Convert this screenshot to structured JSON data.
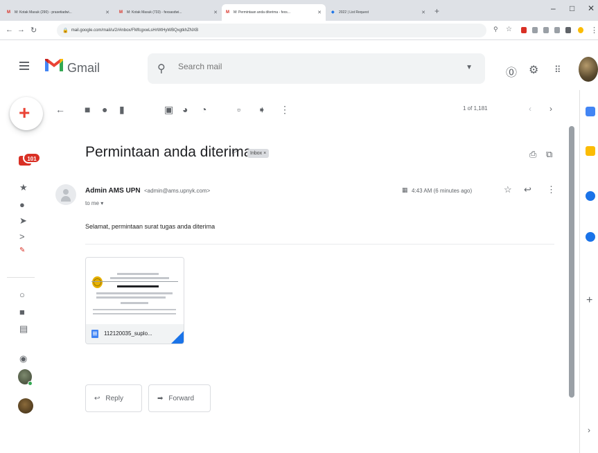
{
  "browser": {
    "tabs": [
      {
        "title": "M: Kotak Masuk (290) - prasetiadwi..."
      },
      {
        "title": "M: Kotak Masuk (733) - fexsasdwi..."
      },
      {
        "title": "M: Permintaan anda diterima - fexs..."
      },
      {
        "title": "2022 | List Request"
      }
    ],
    "url": "mail.google.com/mail/u/2/#inbox/FMfcgxwLsHrWtHyWBQxgtkhZNXB"
  },
  "gmail": {
    "brand": "Gmail",
    "search_placeholder": "Search mail"
  },
  "rail": {
    "inbox_badge": "101"
  },
  "toolbar": {
    "pager": "1 of 1,181"
  },
  "message": {
    "subject": "Permintaan anda diterima",
    "label": "Inbox ×",
    "sender_name": "Admin AMS UPN",
    "sender_email": "<admin@ams.upnyk.com>",
    "to": "to me ▾",
    "time": "4:43 AM (6 minutes ago)",
    "body": "Selamat, permintaan surat tugas anda diterima",
    "attachment_name": "112120035_suplo..."
  },
  "actions": {
    "reply": "Reply",
    "forward": "Forward"
  },
  "colors": {
    "gmail_red": "#d93025",
    "blue": "#1a73e8",
    "yellow": "#fbbc04"
  }
}
